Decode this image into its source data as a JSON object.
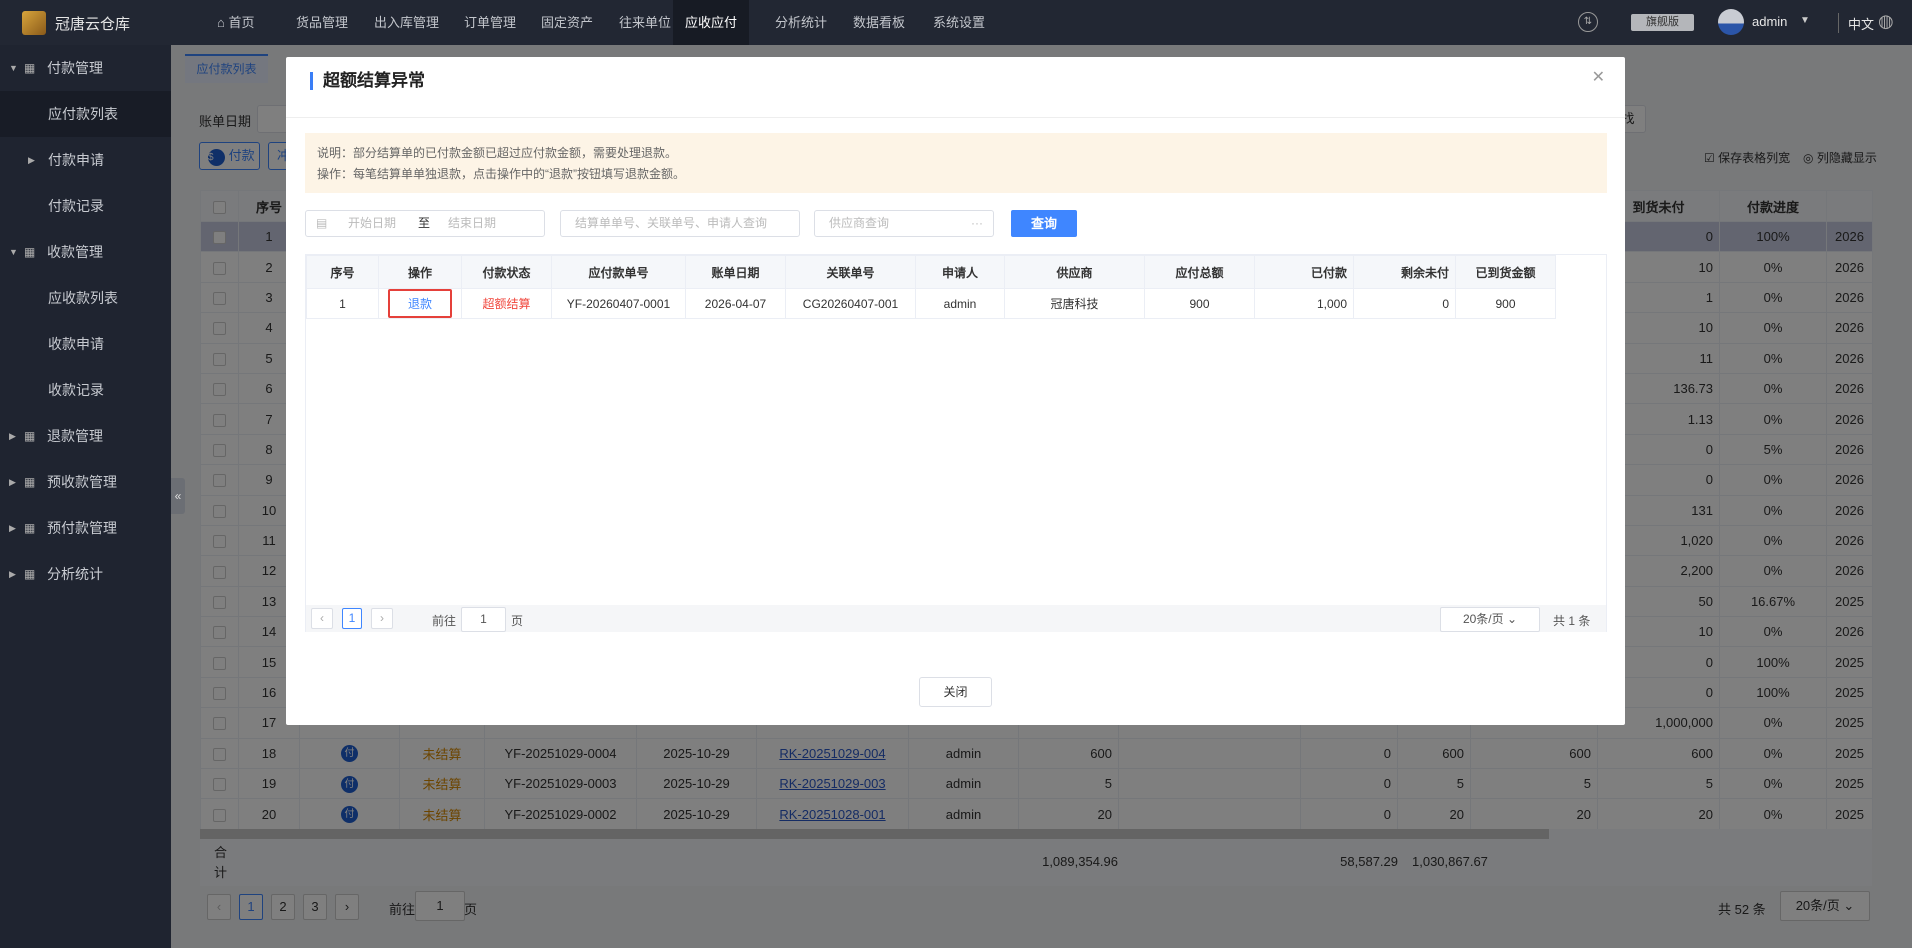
{
  "app": {
    "name": "冠唐云仓库"
  },
  "topnav": {
    "items": [
      "首页",
      "货品管理",
      "出入库管理",
      "订单管理",
      "固定资产",
      "往来单位",
      "应收应付",
      "分析统计",
      "数据看板",
      "系统设置"
    ],
    "active": "应收应付",
    "edition": "旗舰版",
    "user": "admin",
    "lang": "中文"
  },
  "sidebar": {
    "items": [
      {
        "label": "付款管理",
        "type": "group",
        "open": true
      },
      {
        "label": "应付款列表",
        "type": "sub",
        "active": true
      },
      {
        "label": "付款申请",
        "type": "subgroup"
      },
      {
        "label": "付款记录",
        "type": "sub"
      },
      {
        "label": "收款管理",
        "type": "group",
        "open": true
      },
      {
        "label": "应收款列表",
        "type": "sub"
      },
      {
        "label": "收款申请",
        "type": "sub"
      },
      {
        "label": "收款记录",
        "type": "sub"
      },
      {
        "label": "退款管理",
        "type": "group"
      },
      {
        "label": "预收款管理",
        "type": "group"
      },
      {
        "label": "预付款管理",
        "type": "group"
      },
      {
        "label": "分析统计",
        "type": "group"
      }
    ]
  },
  "page": {
    "tab": "应付款列表",
    "filter_label": "账单日期",
    "find_button": "找",
    "pay_button": "付款",
    "second_button": "冲",
    "save_cols": "保存表格列宽",
    "toggle_cols": "列隐藏显示",
    "headers": {
      "index": "序号",
      "arrived_unpaid": "到货未付",
      "progress": "付款进度"
    },
    "rows": [
      {
        "i": "1",
        "au": "0",
        "p": "100%",
        "d": "2026"
      },
      {
        "i": "2",
        "au": "10",
        "p": "0%",
        "d": "2026"
      },
      {
        "i": "3",
        "au": "1",
        "p": "0%",
        "d": "2026"
      },
      {
        "i": "4",
        "au": "10",
        "p": "0%",
        "d": "2026"
      },
      {
        "i": "5",
        "au": "11",
        "p": "0%",
        "d": "2026"
      },
      {
        "i": "6",
        "au": "136.73",
        "p": "0%",
        "d": "2026"
      },
      {
        "i": "7",
        "au": "1.13",
        "p": "0%",
        "d": "2026"
      },
      {
        "i": "8",
        "au": "0",
        "p": "5%",
        "d": "2026"
      },
      {
        "i": "9",
        "au": "0",
        "p": "0%",
        "d": "2026"
      },
      {
        "i": "10",
        "au": "131",
        "p": "0%",
        "d": "2026"
      },
      {
        "i": "11",
        "au": "1,020",
        "p": "0%",
        "d": "2026"
      },
      {
        "i": "12",
        "au": "2,200",
        "p": "0%",
        "d": "2026"
      },
      {
        "i": "13",
        "au": "50",
        "p": "16.67%",
        "d": "2025"
      },
      {
        "i": "14",
        "au": "10",
        "p": "0%",
        "d": "2026"
      },
      {
        "i": "15",
        "au": "0",
        "p": "100%",
        "d": "2025"
      },
      {
        "i": "16",
        "au": "0",
        "p": "100%",
        "d": "2025"
      },
      {
        "i": "17",
        "au": "1,000,000",
        "p": "0%",
        "d": "2025"
      },
      {
        "i": "18",
        "op": "付",
        "st": "未结算",
        "no": "YF-20251029-0004",
        "date": "2025-10-29",
        "rel": "RK-20251029-004",
        "user": "admin",
        "total": "600",
        "c1": "",
        "c2": "0",
        "c3": "600",
        "c4": "600",
        "au": "600",
        "p": "0%",
        "d": "2025"
      },
      {
        "i": "19",
        "op": "付",
        "st": "未结算",
        "no": "YF-20251029-0003",
        "date": "2025-10-29",
        "rel": "RK-20251029-003",
        "user": "admin",
        "total": "5",
        "c1": "",
        "c2": "0",
        "c3": "5",
        "c4": "5",
        "au": "5",
        "p": "0%",
        "d": "2025"
      },
      {
        "i": "20",
        "op": "付",
        "st": "未结算",
        "no": "YF-20251029-0002",
        "date": "2025-10-29",
        "rel": "RK-20251028-001",
        "user": "admin",
        "total": "20",
        "c1": "",
        "c2": "0",
        "c3": "20",
        "c4": "20",
        "au": "20",
        "p": "0%",
        "d": "2025"
      }
    ],
    "totals": {
      "label": "合计",
      "total": "1,089,354.96",
      "c2": "58,587.29",
      "c3": "1,030,867.67"
    },
    "pagination": {
      "pages": [
        "1",
        "2",
        "3"
      ],
      "current": "1",
      "goto_prefix": "前往",
      "goto_value": "1",
      "goto_suffix": "页",
      "total": "共 52 条",
      "page_size": "20条/页"
    }
  },
  "modal": {
    "title": "超额结算异常",
    "notice": [
      "说明：部分结算单的已付款金额已超过应付款金额，需要处理退款。",
      "操作：每笔结算单单独退款，点击操作中的“退款”按钮填写退款金额。"
    ],
    "filters": {
      "start_placeholder": "开始日期",
      "sep": "至",
      "end_placeholder": "结束日期",
      "keyword_placeholder": "结算单单号、关联单号、申请人查询",
      "supplier_placeholder": "供应商查询",
      "query": "查询"
    },
    "columns": [
      "序号",
      "操作",
      "付款状态",
      "应付款单号",
      "账单日期",
      "关联单号",
      "申请人",
      "供应商",
      "应付总额",
      "已付款",
      "剩余未付",
      "已到货金额"
    ],
    "rows": [
      {
        "i": "1",
        "op": "退款",
        "status": "超额结算",
        "no": "YF-20260407-0001",
        "date": "2026-04-07",
        "rel": "CG20260407-001",
        "user": "admin",
        "supplier": "冠唐科技",
        "total": "900",
        "paid": "1,000",
        "remain": "0",
        "arrived": "900"
      }
    ],
    "pagination": {
      "current": "1",
      "goto_prefix": "前往",
      "goto_value": "1",
      "goto_suffix": "页",
      "page_size": "20条/页",
      "total": "共 1 条"
    },
    "close": "关闭"
  },
  "colors": {
    "accent": "#3f86ff",
    "danger": "#f0463c",
    "warning": "#d98a00",
    "topbar": "#222733"
  }
}
